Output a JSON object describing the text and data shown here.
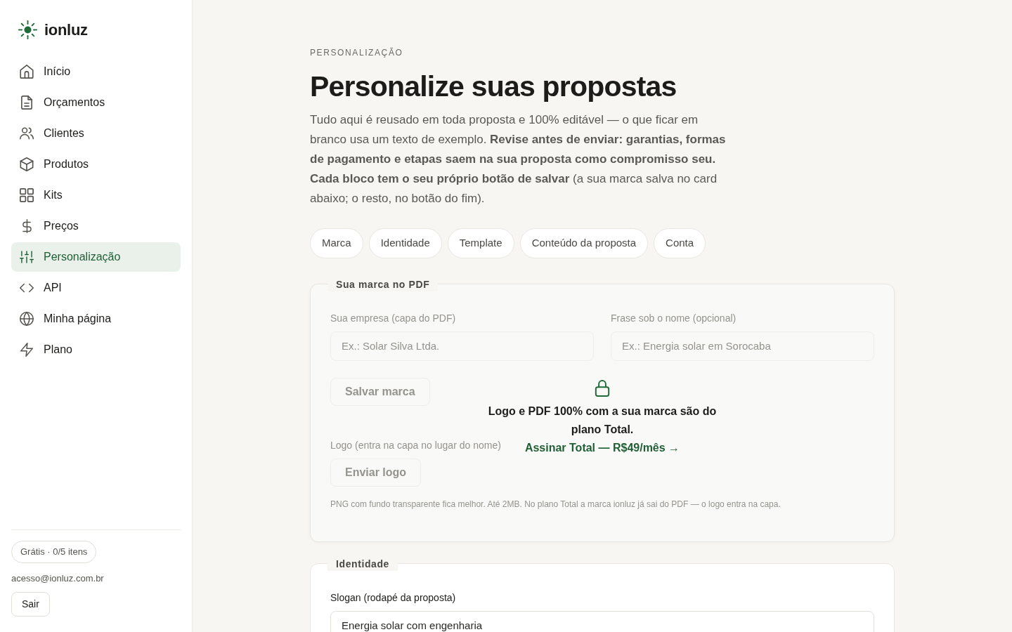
{
  "brand": {
    "name": "ionluz"
  },
  "sidebar": {
    "items": [
      {
        "label": "Início",
        "selected": false
      },
      {
        "label": "Orçamentos",
        "selected": false
      },
      {
        "label": "Clientes",
        "selected": false
      },
      {
        "label": "Produtos",
        "selected": false
      },
      {
        "label": "Kits",
        "selected": false
      },
      {
        "label": "Preços",
        "selected": false
      },
      {
        "label": "Personalização",
        "selected": true
      },
      {
        "label": "API",
        "selected": false
      },
      {
        "label": "Minha página",
        "selected": false
      },
      {
        "label": "Plano",
        "selected": false
      }
    ],
    "plan_badge": "Grátis · 0/5 itens",
    "email": "acesso@ionluz.com.br",
    "logout_button": "Sair"
  },
  "header": {
    "eyebrow": "PERSONALIZAÇÃO",
    "title": "Personalize suas propostas",
    "intro": "Tudo aqui é reusado em toda proposta e 100% editável — o que ficar em branco usa um texto de exemplo. **Revise antes de enviar: garantias, formas de pagamento e etapas saem na sua proposta como compromisso seu. Cada bloco tem o seu próprio botão de salvar** (a sua marca salva no card abaixo; o resto, no botão do fim)."
  },
  "section_links": [
    "Marca",
    "Identidade",
    "Template",
    "Conteúdo da proposta",
    "Conta"
  ],
  "sections": [
    {
      "legend": "Sua marca no PDF",
      "locked": true,
      "fields": [
        {
          "label": "Sua empresa (capa do PDF)",
          "placeholder": "Ex.: Solar Silva Ltda."
        },
        {
          "label": "Frase sob o nome (opcional)",
          "placeholder": "Ex.: Energia solar em Sorocaba"
        }
      ],
      "save_button": "Salvar marca",
      "logo_label": "Logo (entra na capa no lugar do nome)",
      "upload_button": "Enviar logo",
      "help": "PNG com fundo transparente fica melhor. Até 2MB. No plano Total a marca ionluz já sai do PDF — o logo entra na capa.",
      "lock_message": "Logo e PDF 100% com a sua marca são do plano Total.",
      "upgrade_link": "Assinar Total — R$49/mês →"
    },
    {
      "legend": "Identidade",
      "locked": false,
      "fields": [
        {
          "label": "Slogan (rodapé da proposta)",
          "value": "Energia solar com engenharia"
        }
      ]
    }
  ]
}
